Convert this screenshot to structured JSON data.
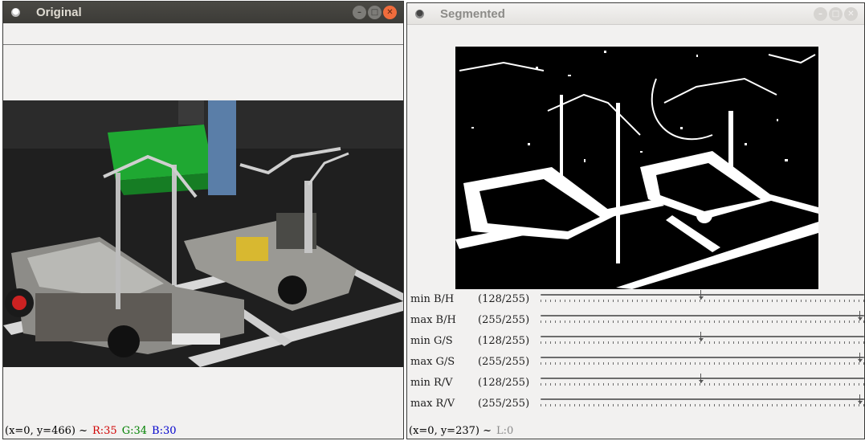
{
  "original": {
    "title": "Original",
    "status": {
      "coords": "(x=0, y=466) ~",
      "r": "R:35",
      "g": "G:34",
      "b": "B:30"
    }
  },
  "segmented": {
    "title": "Segmented",
    "status": {
      "coords": "(x=0, y=237) ~",
      "l": "L:0"
    },
    "trackbars": [
      {
        "name": "min B/H",
        "value_text": "(128/255)",
        "value": 128,
        "max": 255
      },
      {
        "name": "max B/H",
        "value_text": "(255/255)",
        "value": 255,
        "max": 255
      },
      {
        "name": "min G/S",
        "value_text": "(128/255)",
        "value": 128,
        "max": 255
      },
      {
        "name": "max G/S",
        "value_text": "(255/255)",
        "value": 255,
        "max": 255
      },
      {
        "name": "min R/V",
        "value_text": "(128/255)",
        "value": 128,
        "max": 255
      },
      {
        "name": "max R/V",
        "value_text": "(255/255)",
        "value": 255,
        "max": 255
      }
    ]
  },
  "icons": {
    "window": "app-icon",
    "minimize": "minimize-icon",
    "maximize": "maximize-icon",
    "close": "close-icon"
  },
  "colors": {
    "dark_titlebar": "#3c3b37",
    "close_button": "#f06c3c",
    "window_bg": "#f2f1f0"
  }
}
